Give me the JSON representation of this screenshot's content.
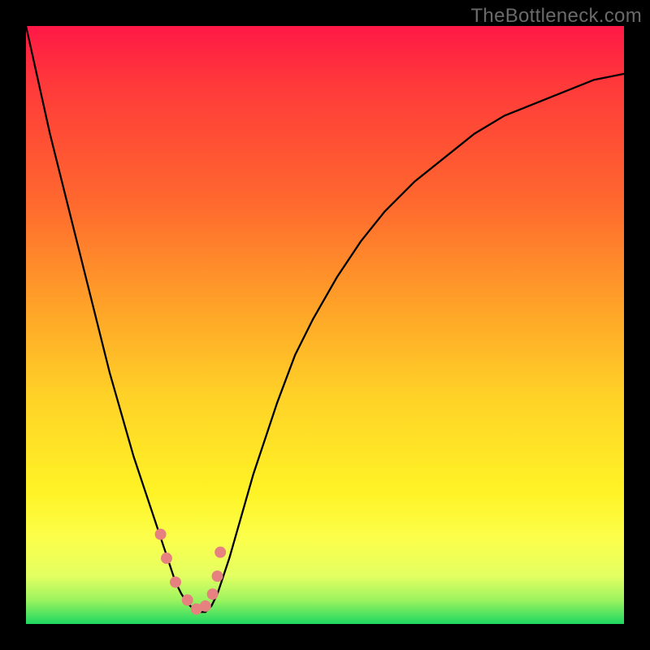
{
  "watermark": "TheBottleneck.com",
  "colors": {
    "frame": "#000000",
    "gradient_top": "#ff1846",
    "gradient_mid1": "#ffa628",
    "gradient_mid2": "#fff326",
    "gradient_bottom": "#1ed760",
    "curve": "#000000",
    "dot": "#e7817f"
  },
  "chart_data": {
    "type": "line",
    "title": "",
    "xlabel": "",
    "ylabel": "",
    "xlim": [
      0,
      100
    ],
    "ylim": [
      0,
      100
    ],
    "x": [
      0,
      2,
      4,
      6,
      8,
      10,
      12,
      14,
      16,
      18,
      20,
      22,
      23,
      24,
      25,
      26,
      27,
      28,
      29,
      30,
      31,
      32,
      34,
      36,
      38,
      40,
      42,
      45,
      48,
      52,
      56,
      60,
      65,
      70,
      75,
      80,
      85,
      90,
      95,
      100
    ],
    "values": [
      100,
      91,
      82,
      74,
      66,
      58,
      50,
      42,
      35,
      28,
      22,
      16,
      13,
      10,
      7,
      5,
      3.5,
      2.5,
      2,
      2,
      3,
      5,
      11,
      18,
      25,
      31,
      37,
      45,
      51,
      58,
      64,
      69,
      74,
      78,
      82,
      85,
      87,
      89,
      91,
      92
    ],
    "minimum_x": 29,
    "markers": [
      {
        "x": 22.5,
        "y": 15
      },
      {
        "x": 23.5,
        "y": 11
      },
      {
        "x": 25.0,
        "y": 7
      },
      {
        "x": 27.0,
        "y": 4
      },
      {
        "x": 28.5,
        "y": 2.5
      },
      {
        "x": 30.0,
        "y": 3
      },
      {
        "x": 31.2,
        "y": 5
      },
      {
        "x": 32.0,
        "y": 8
      },
      {
        "x": 32.5,
        "y": 12
      }
    ],
    "annotations": []
  }
}
